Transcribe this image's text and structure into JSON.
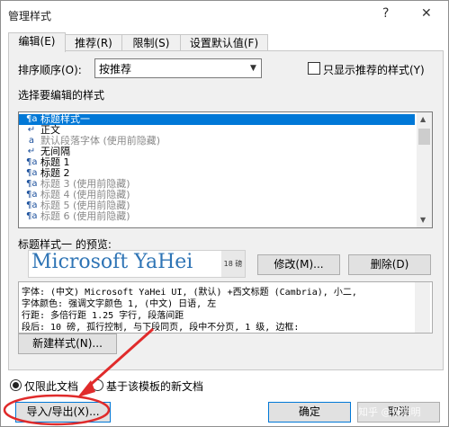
{
  "window": {
    "title": "管理样式",
    "help": "?",
    "close": "✕"
  },
  "tabs": [
    {
      "label": "编辑(E)"
    },
    {
      "label": "推荐(R)"
    },
    {
      "label": "限制(S)"
    },
    {
      "label": "设置默认值(F)"
    }
  ],
  "sort": {
    "label": "排序顺序(O):",
    "value": "按推荐",
    "arrow": "▼"
  },
  "show_recommended_only": {
    "label": "只显示推荐的样式(Y)",
    "checked": false
  },
  "style_list": {
    "label": "选择要编辑的样式",
    "items": [
      {
        "icon": "¶a",
        "text": "标题样式一",
        "selected": true,
        "hidden": false
      },
      {
        "icon": "↵",
        "text": "正文",
        "selected": false,
        "hidden": false
      },
      {
        "icon": "a",
        "text": "默认段落字体  (使用前隐藏)",
        "selected": false,
        "hidden": true
      },
      {
        "icon": "↵",
        "text": "无间隔",
        "selected": false,
        "hidden": false
      },
      {
        "icon": "¶a",
        "text": "标题 1",
        "selected": false,
        "hidden": false
      },
      {
        "icon": "¶a",
        "text": "标题 2",
        "selected": false,
        "hidden": false
      },
      {
        "icon": "¶a",
        "text": "标题 3  (使用前隐藏)",
        "selected": false,
        "hidden": true
      },
      {
        "icon": "¶a",
        "text": "标题 4  (使用前隐藏)",
        "selected": false,
        "hidden": true
      },
      {
        "icon": "¶a",
        "text": "标题 5  (使用前隐藏)",
        "selected": false,
        "hidden": true
      },
      {
        "icon": "¶a",
        "text": "标题 6  (使用前隐藏)",
        "selected": false,
        "hidden": true
      }
    ]
  },
  "preview": {
    "label": "标题样式一 的预览:",
    "font_name": "Microsoft YaHei",
    "size_badge": "18 磅"
  },
  "buttons": {
    "modify": "修改(M)...",
    "delete": "删除(D)",
    "new_style": "新建样式(N)...",
    "import_export": "导入/导出(X)...",
    "ok": "确定",
    "cancel": "取消"
  },
  "description": [
    "字体: (中文) Microsoft YaHei UI, (默认) +西文标题 (Cambria), 小二,",
    "字体颜色: 强调文字颜色 1, (中文) 日语, 左",
    "    行距: 多倍行距 1.25 字行, 段落间距",
    "    段后: 10 磅, 孤行控制, 与下段同页, 段中不分页, 1 级, 边框:"
  ],
  "scope": {
    "this_doc": "仅限此文档",
    "template": "基于该模板的新文档",
    "selected": "this_doc"
  },
  "watermark": "知乎 @张浩明",
  "colors": {
    "accent": "#0078d7",
    "annotation": "#e02b2b"
  }
}
